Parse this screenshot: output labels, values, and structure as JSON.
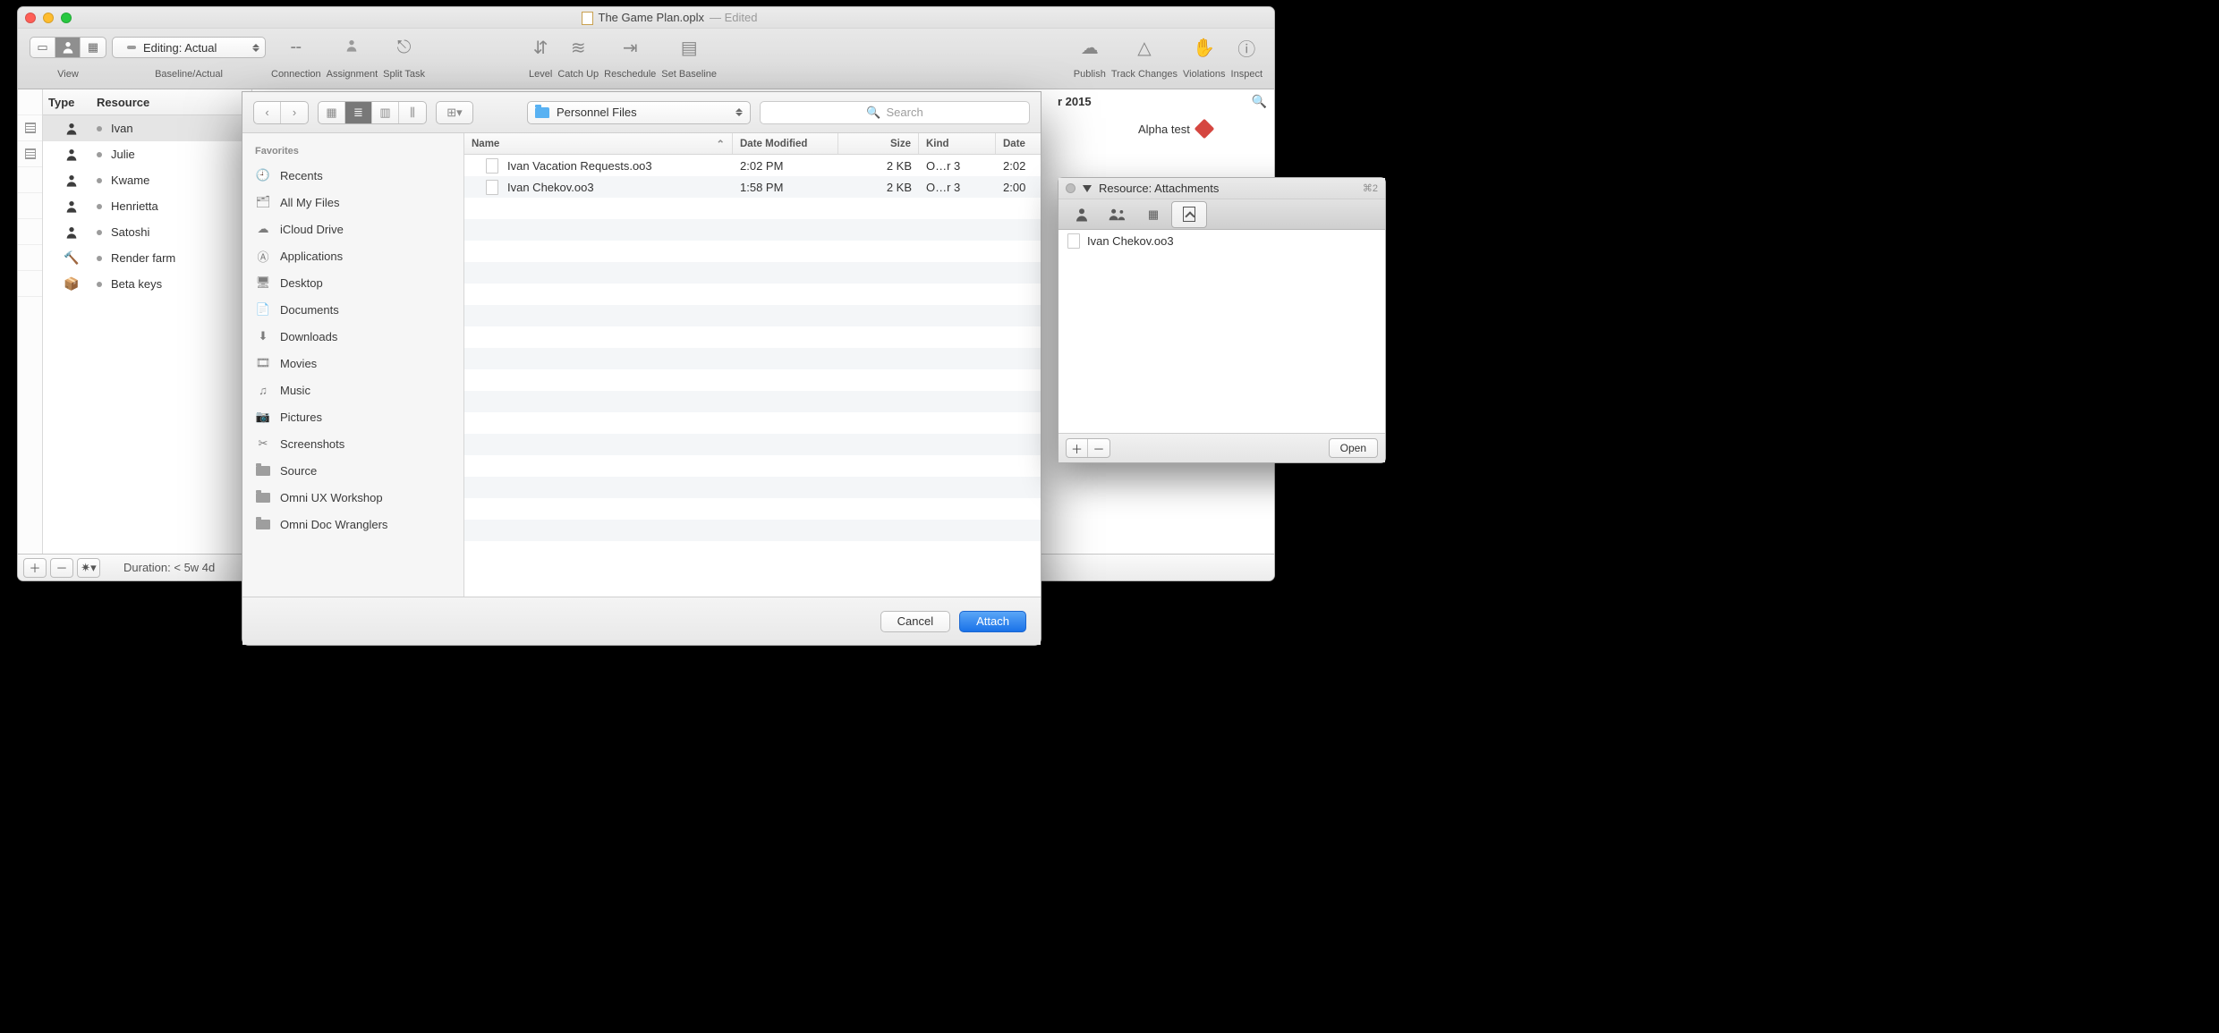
{
  "window": {
    "title": "The Game Plan.oplx",
    "edited_suffix": "— Edited"
  },
  "toolbar": {
    "view_label": "View",
    "baseline_pill": "Editing: Actual",
    "baseline_label": "Baseline/Actual",
    "items": [
      {
        "label": "Connection"
      },
      {
        "label": "Assignment"
      },
      {
        "label": "Split Task"
      },
      {
        "label": "Level"
      },
      {
        "label": "Catch Up"
      },
      {
        "label": "Reschedule"
      },
      {
        "label": "Set Baseline"
      },
      {
        "label": "Publish"
      },
      {
        "label": "Track Changes"
      },
      {
        "label": "Violations"
      },
      {
        "label": "Inspect"
      }
    ]
  },
  "resource_columns": {
    "type": "Type",
    "resource": "Resource"
  },
  "resources": [
    {
      "name": "Ivan",
      "kind": "person",
      "selected": true
    },
    {
      "name": "Julie",
      "kind": "person"
    },
    {
      "name": "Kwame",
      "kind": "person"
    },
    {
      "name": "Henrietta",
      "kind": "person"
    },
    {
      "name": "Satoshi",
      "kind": "person"
    },
    {
      "name": "Render farm",
      "kind": "tool"
    },
    {
      "name": "Beta keys",
      "kind": "material"
    }
  ],
  "gantt": {
    "year_partial": "r 2015",
    "milestone_label": "Alpha test"
  },
  "status": {
    "duration": "Duration: < 5w 4d"
  },
  "file_sheet": {
    "folder_name": "Personnel Files",
    "search_placeholder": "Search",
    "sidebar_heading": "Favorites",
    "sidebar": [
      "Recents",
      "All My Files",
      "iCloud Drive",
      "Applications",
      "Desktop",
      "Documents",
      "Downloads",
      "Movies",
      "Music",
      "Pictures",
      "Screenshots",
      "Source",
      "Omni UX Workshop",
      "Omni Doc Wranglers"
    ],
    "columns": {
      "name": "Name",
      "modified": "Date Modified",
      "size": "Size",
      "kind": "Kind",
      "date": "Date"
    },
    "files": [
      {
        "name": "Ivan Vacation Requests.oo3",
        "modified": "2:02 PM",
        "size": "2 KB",
        "kind": "O…r 3",
        "date": "2:02"
      },
      {
        "name": "Ivan Chekov.oo3",
        "modified": "1:58 PM",
        "size": "2 KB",
        "kind": "O…r 3",
        "date": "2:00"
      }
    ],
    "cancel": "Cancel",
    "attach": "Attach"
  },
  "inspector": {
    "title": "Resource: Attachments",
    "shortcut": "⌘2",
    "attachments": [
      "Ivan Chekov.oo3"
    ],
    "open": "Open"
  }
}
